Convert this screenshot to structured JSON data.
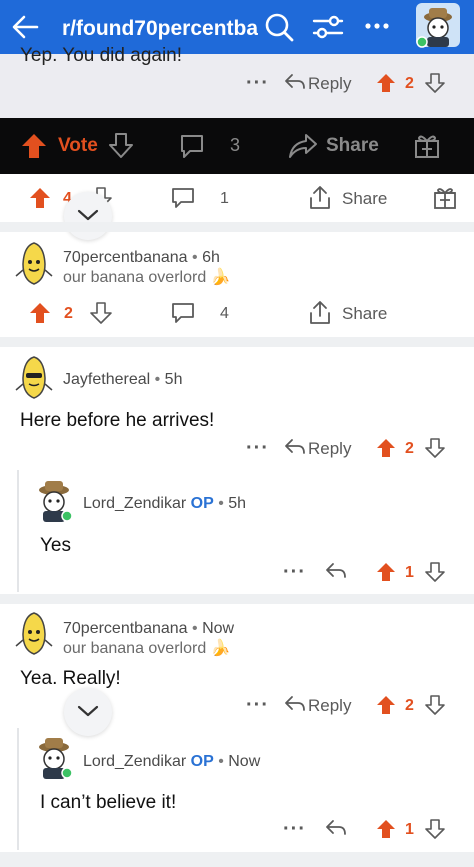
{
  "header": {
    "subreddit": "r/found70percentbanana"
  },
  "top_comment": {
    "text": "Yep. You did again!",
    "reply_label": "Reply",
    "votes": "2"
  },
  "post_bar": {
    "vote_label": "Vote",
    "comments": "3",
    "share_label": "Share"
  },
  "partial_row": {
    "votes": "4",
    "comments": "1",
    "share_label": "Share"
  },
  "comments": [
    {
      "user": "70percentbanana",
      "time": "6h",
      "flair": "our banana overlord 🍌",
      "votes": "2",
      "comments": "4",
      "share_label": "Share"
    },
    {
      "user": "Jayfethereal",
      "time": "5h",
      "text": "Here before he arrives!",
      "reply_label": "Reply",
      "votes": "2"
    },
    {
      "user": "Lord_Zendikar",
      "op": "OP",
      "time": "5h",
      "text": "Yes",
      "votes": "1"
    },
    {
      "user": "70percentbanana",
      "time": "Now",
      "flair": "our banana overlord 🍌",
      "text": "Yea. Really!",
      "reply_label": "Reply",
      "votes": "2"
    },
    {
      "user": "Lord_Zendikar",
      "op": "OP",
      "time": "Now",
      "text": "I can’t believe it!",
      "votes": "1"
    }
  ],
  "colors": {
    "header_bg": "#1f6ad9",
    "upvote": "#e2501f",
    "op_blue": "#2a72d4",
    "separator": "#eef0f2"
  }
}
